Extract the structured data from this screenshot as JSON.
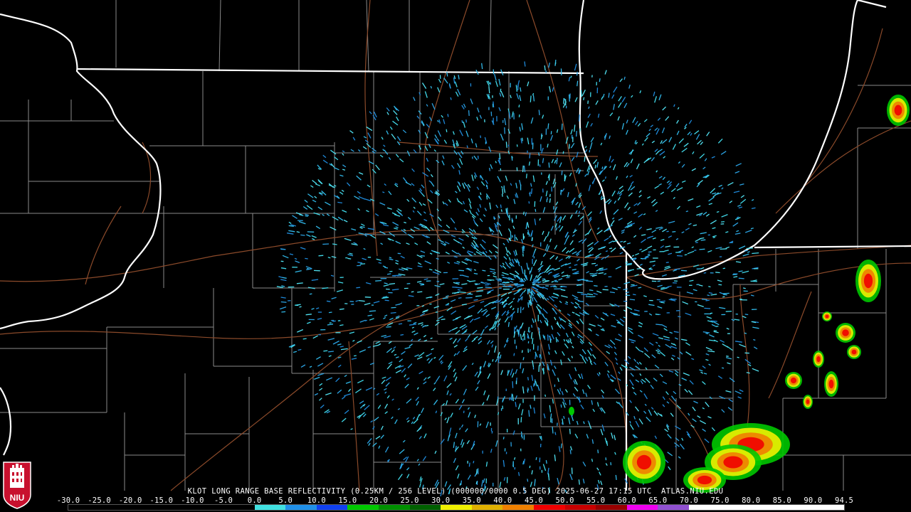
{
  "product": {
    "caption": "KLOT LONG RANGE BASE REFLECTIVITY (0.25KM / 256 LEVEL) (000000/0000 0.5 DEG) 2025-06-27 17:15 UTC  ATLAS.NIU.EDU",
    "site": "KLOT",
    "timestamp": "2025-06-27 17:15 UTC",
    "source": "ATLAS.NIU.EDU"
  },
  "logo": {
    "label": "NIU",
    "icon": "niu-tower-logo-icon"
  },
  "colorbar": {
    "ticks": [
      "-30.0",
      "-25.0",
      "-20.0",
      "-15.0",
      "-10.0",
      "-5.0",
      "0.0",
      "5.0",
      "10.0",
      "15.0",
      "20.0",
      "25.0",
      "30.0",
      "35.0",
      "40.0",
      "45.0",
      "50.0",
      "55.0",
      "60.0",
      "65.0",
      "70.0",
      "75.0",
      "80.0",
      "85.0",
      "90.0",
      "94.5"
    ],
    "colors": [
      "#000000",
      "#000000",
      "#000000",
      "#000000",
      "#000000",
      "#000000",
      "#40e0e0",
      "#2090e8",
      "#1040f0",
      "#00c800",
      "#009000",
      "#006000",
      "#f0f000",
      "#e0b000",
      "#f08000",
      "#f00000",
      "#c80000",
      "#980000",
      "#f000f0",
      "#9050d0",
      "#ffffff",
      "#ffffff",
      "#ffffff",
      "#ffffff",
      "#ffffff"
    ]
  },
  "map": {
    "background": "#000000",
    "state_border_color": "#ffffff",
    "county_border_color": "#8a8a8a",
    "road_color": "#8b4a2a",
    "lake": "Lake Michigan"
  }
}
